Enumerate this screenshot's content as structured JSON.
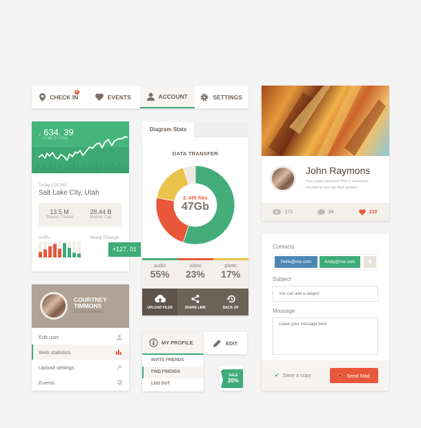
{
  "nav": {
    "tabs": [
      {
        "label": "CHECK IN",
        "icon": "map-pin-icon",
        "badge": "3"
      },
      {
        "label": "EVENTS",
        "icon": "heart-icon"
      },
      {
        "label": "ACCOUNT",
        "icon": "user-icon",
        "active": true
      },
      {
        "label": "SETTINGS",
        "icon": "gear-icon"
      }
    ]
  },
  "stock": {
    "price": ". 634. 39",
    "change": "+2.38 (3.71%)",
    "time": "Today 2:25 PM",
    "location": "Salt Lake City, Utah",
    "shares_value": "13.5 M",
    "shares_label": "Shares Traded",
    "cap_value": "28.44 B",
    "cap_label": "Market Cap",
    "ticker": "AAPL",
    "yearly_label": "Yearly Change",
    "yearly_value": "+127. 01",
    "bars": [
      0.35,
      0.5,
      0.7,
      0.85,
      0.55,
      0.9,
      0.6,
      0.3,
      0.25
    ]
  },
  "diagram": {
    "tab": "Diagram Stats",
    "title": "DATA TRANSFER",
    "files": "2. 435 files",
    "total": "47Gb",
    "segments": [
      {
        "label": "audio",
        "value": 55,
        "display": "55%",
        "color": "#45ad7a"
      },
      {
        "label": "video",
        "value": 23,
        "display": "23%",
        "color": "#e8573a"
      },
      {
        "label": "photo",
        "value": 17,
        "display": "17%",
        "color": "#eac24c"
      },
      {
        "value": 5,
        "color": "#efe9e4"
      }
    ],
    "actions": [
      "UPLOAD FILES",
      "SHARE LINK",
      "BACK UP"
    ]
  },
  "profile": {
    "name_line1": "COURTNEY",
    "name_line2": "TIMMONS",
    "followers": "15,323 followers",
    "menu": [
      {
        "label": "Edit user",
        "icon": "user-icon"
      },
      {
        "label": "Web statistics",
        "icon": "bar-chart-icon",
        "active": true
      },
      {
        "label": "Upload settings",
        "icon": "pin-icon"
      },
      {
        "label": "Events",
        "icon": "map-pin-icon"
      }
    ]
  },
  "myprofile": {
    "label": "MY PROFILE",
    "edit": "EDIT",
    "items": [
      "INVITE FRIENDS",
      "FIND FRIENDS",
      "LOG OUT"
    ]
  },
  "sale": {
    "line1": "SALE",
    "line2": "20%"
  },
  "person": {
    "name": "John Raymons",
    "bio1": "Your talent amazes! This is awesome.",
    "bio2": "Excited to see the final product.",
    "views": "172",
    "comments": "34",
    "likes": "210"
  },
  "form": {
    "contacts_label": "Contacts",
    "contacts": [
      "Hello@me.com",
      "Andy@me.com"
    ],
    "subject_label": "Subject",
    "subject_placeholder": "You can add a subject",
    "message_label": "Message",
    "message_placeholder": "Leave your message here",
    "save_copy": "Save a copy",
    "send": "Send Mail"
  }
}
